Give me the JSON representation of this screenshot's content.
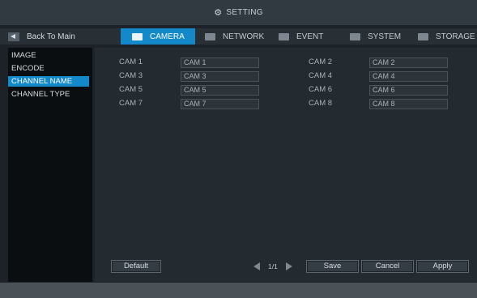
{
  "title": {
    "text": "SETTING",
    "icon": "gear-icon"
  },
  "nav": {
    "back_label": "Back To Main",
    "tabs": [
      {
        "label": "CAMERA",
        "icon": "camera-icon",
        "active": true
      },
      {
        "label": "NETWORK",
        "icon": "network-icon",
        "active": false
      },
      {
        "label": "EVENT",
        "icon": "event-icon",
        "active": false
      },
      {
        "label": "SYSTEM",
        "icon": "system-icon",
        "active": false
      },
      {
        "label": "STORAGE",
        "icon": "storage-icon",
        "active": false
      }
    ]
  },
  "sidebar": {
    "items": [
      {
        "label": "IMAGE",
        "active": false
      },
      {
        "label": "ENCODE",
        "active": false
      },
      {
        "label": "CHANNEL NAME",
        "active": true
      },
      {
        "label": "CHANNEL TYPE",
        "active": false
      }
    ]
  },
  "channels": [
    {
      "label": "CAM 1",
      "value": "CAM 1"
    },
    {
      "label": "CAM 2",
      "value": "CAM 2"
    },
    {
      "label": "CAM 3",
      "value": "CAM 3"
    },
    {
      "label": "CAM 4",
      "value": "CAM 4"
    },
    {
      "label": "CAM 5",
      "value": "CAM 5"
    },
    {
      "label": "CAM 6",
      "value": "CAM 6"
    },
    {
      "label": "CAM 7",
      "value": "CAM 7"
    },
    {
      "label": "CAM 8",
      "value": "CAM 8"
    }
  ],
  "pager": {
    "text": "1/1"
  },
  "buttons": {
    "default": "Default",
    "save": "Save",
    "cancel": "Cancel",
    "apply": "Apply"
  },
  "colors": {
    "accent": "#1489c9",
    "background": "#1c2227",
    "panel": "#232a30",
    "sidebar": "#0b0e11"
  }
}
